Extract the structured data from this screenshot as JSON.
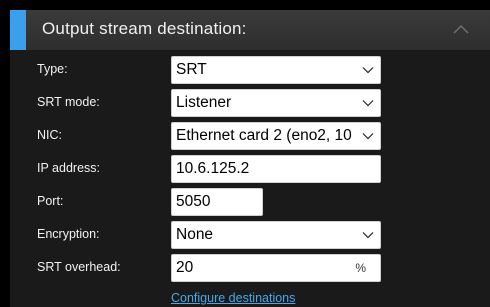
{
  "header": {
    "title": "Output stream destination:",
    "collapse_icon": "chevron-up-icon"
  },
  "fields": {
    "type": {
      "label": "Type:",
      "value": "SRT"
    },
    "srt_mode": {
      "label": "SRT mode:",
      "value": "Listener"
    },
    "nic": {
      "label": "NIC:",
      "value": "Ethernet card 2 (eno2, 10"
    },
    "ip_address": {
      "label": "IP address:",
      "value": "10.6.125.2"
    },
    "port": {
      "label": "Port:",
      "value": "5050"
    },
    "encryption": {
      "label": "Encryption:",
      "value": "None"
    },
    "srt_overhead": {
      "label": "SRT overhead:",
      "value": "20",
      "unit": "%"
    }
  },
  "configure_link": "Configure destinations",
  "colors": {
    "accent": "#3aa0ee",
    "link": "#4aa7e8",
    "panel": "#1a1a1a"
  }
}
